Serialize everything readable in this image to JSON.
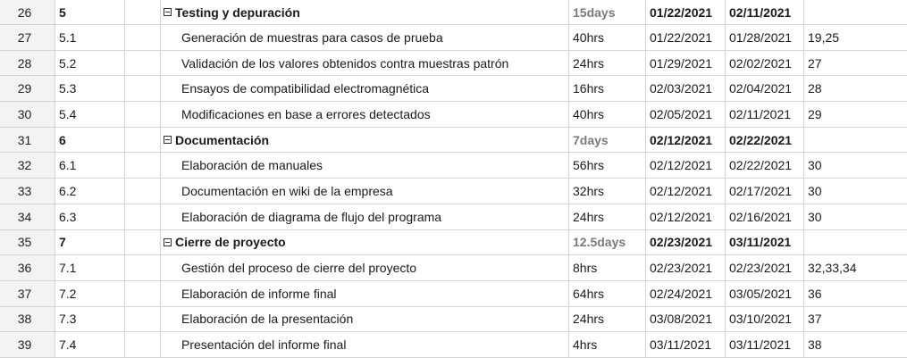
{
  "rows": [
    {
      "num": "26",
      "wbs": "5",
      "name": "Testing y depuración",
      "dur": "15days",
      "start": "01/22/2021",
      "end": "02/11/2021",
      "pred": "",
      "summary": true
    },
    {
      "num": "27",
      "wbs": "5.1",
      "name": "Generación de muestras para casos de prueba",
      "dur": "40hrs",
      "start": "01/22/2021",
      "end": "01/28/2021",
      "pred": "19,25",
      "summary": false
    },
    {
      "num": "28",
      "wbs": "5.2",
      "name": "Validación de los valores obtenidos contra muestras patrón",
      "dur": "24hrs",
      "start": "01/29/2021",
      "end": "02/02/2021",
      "pred": "27",
      "summary": false
    },
    {
      "num": "29",
      "wbs": "5.3",
      "name": "Ensayos de compatibilidad electromagnética",
      "dur": "16hrs",
      "start": "02/03/2021",
      "end": "02/04/2021",
      "pred": "28",
      "summary": false
    },
    {
      "num": "30",
      "wbs": "5.4",
      "name": "Modificaciones en base a errores detectados",
      "dur": "40hrs",
      "start": "02/05/2021",
      "end": "02/11/2021",
      "pred": "29",
      "summary": false
    },
    {
      "num": "31",
      "wbs": "6",
      "name": "Documentación",
      "dur": "7days",
      "start": "02/12/2021",
      "end": "02/22/2021",
      "pred": "",
      "summary": true
    },
    {
      "num": "32",
      "wbs": "6.1",
      "name": "Elaboración de manuales",
      "dur": "56hrs",
      "start": "02/12/2021",
      "end": "02/22/2021",
      "pred": "30",
      "summary": false
    },
    {
      "num": "33",
      "wbs": "6.2",
      "name": "Documentación en wiki de la empresa",
      "dur": "32hrs",
      "start": "02/12/2021",
      "end": "02/17/2021",
      "pred": "30",
      "summary": false
    },
    {
      "num": "34",
      "wbs": "6.3",
      "name": "Elaboración de diagrama de flujo del programa",
      "dur": "24hrs",
      "start": "02/12/2021",
      "end": "02/16/2021",
      "pred": "30",
      "summary": false
    },
    {
      "num": "35",
      "wbs": "7",
      "name": "Cierre de proyecto",
      "dur": "12.5days",
      "start": "02/23/2021",
      "end": "03/11/2021",
      "pred": "",
      "summary": true
    },
    {
      "num": "36",
      "wbs": "7.1",
      "name": "Gestión del proceso de cierre del proyecto",
      "dur": "8hrs",
      "start": "02/23/2021",
      "end": "02/23/2021",
      "pred": "32,33,34",
      "summary": false
    },
    {
      "num": "37",
      "wbs": "7.2",
      "name": "Elaboración de informe final",
      "dur": "64hrs",
      "start": "02/24/2021",
      "end": "03/05/2021",
      "pred": "36",
      "summary": false
    },
    {
      "num": "38",
      "wbs": "7.3",
      "name": "Elaboración de la presentación",
      "dur": "24hrs",
      "start": "03/08/2021",
      "end": "03/10/2021",
      "pred": "37",
      "summary": false
    },
    {
      "num": "39",
      "wbs": "7.4",
      "name": "Presentación del informe final",
      "dur": "4hrs",
      "start": "03/11/2021",
      "end": "03/11/2021",
      "pred": "38",
      "summary": false
    }
  ]
}
